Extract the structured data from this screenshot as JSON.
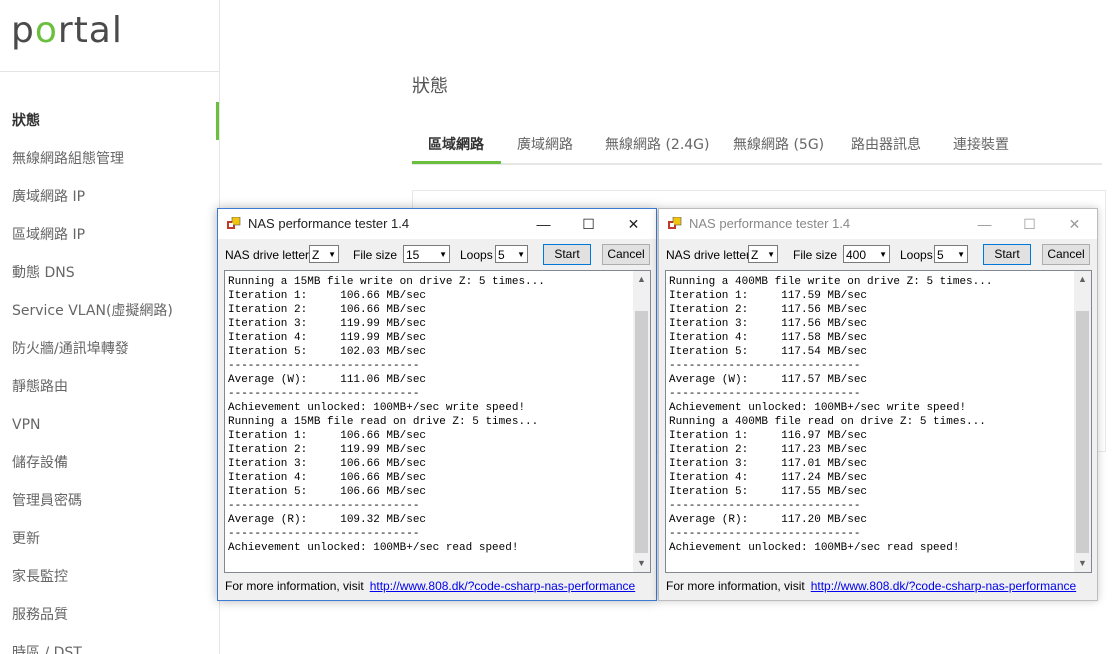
{
  "sidebar": {
    "logo": "portal",
    "items": [
      {
        "label": "狀態",
        "active": true
      },
      {
        "label": "無線網路組態管理"
      },
      {
        "label": "廣域網路 IP"
      },
      {
        "label": "區域網路 IP"
      },
      {
        "label": "動態 DNS"
      },
      {
        "label": "Service VLAN(虛擬網路)"
      },
      {
        "label": "防火牆/通訊埠轉發"
      },
      {
        "label": "靜態路由"
      },
      {
        "label": "VPN"
      },
      {
        "label": "儲存設備"
      },
      {
        "label": "管理員密碼"
      },
      {
        "label": "更新"
      },
      {
        "label": "家長監控"
      },
      {
        "label": "服務品質"
      },
      {
        "label": "時區 / DST"
      }
    ]
  },
  "main": {
    "title": "狀態",
    "tabs": [
      "區域網路",
      "廣域網路",
      "無線網路 (2.4G)",
      "無線網路 (5G)",
      "路由器訊息",
      "連接裝置"
    ]
  },
  "windows": [
    {
      "title": "NAS performance tester 1.4",
      "drive_label": "NAS drive letter",
      "drive_value": "Z",
      "filesize_label": "File size",
      "filesize_value": "15",
      "loops_label": "Loops",
      "loops_value": "5",
      "start_label": "Start",
      "cancel_label": "Cancel",
      "console": [
        "Running a 15MB file write on drive Z: 5 times...",
        "Iteration 1:     106.66 MB/sec",
        "Iteration 2:     106.66 MB/sec",
        "Iteration 3:     119.99 MB/sec",
        "Iteration 4:     119.99 MB/sec",
        "Iteration 5:     102.03 MB/sec",
        "-----------------------------",
        "Average (W):     111.06 MB/sec",
        "-----------------------------",
        "Achievement unlocked: 100MB+/sec write speed!",
        "Running a 15MB file read on drive Z: 5 times...",
        "Iteration 1:     106.66 MB/sec",
        "Iteration 2:     119.99 MB/sec",
        "Iteration 3:     106.66 MB/sec",
        "Iteration 4:     106.66 MB/sec",
        "Iteration 5:     106.66 MB/sec",
        "-----------------------------",
        "Average (R):     109.32 MB/sec",
        "-----------------------------",
        "Achievement unlocked: 100MB+/sec read speed!"
      ],
      "footer_text": "For more information, visit",
      "footer_link": "http://www.808.dk/?code-csharp-nas-performance"
    },
    {
      "title": "NAS performance tester 1.4",
      "drive_label": "NAS drive letter",
      "drive_value": "Z",
      "filesize_label": "File size",
      "filesize_value": "400",
      "loops_label": "Loops",
      "loops_value": "5",
      "start_label": "Start",
      "cancel_label": "Cancel",
      "console": [
        "Running a 400MB file write on drive Z: 5 times...",
        "Iteration 1:     117.59 MB/sec",
        "Iteration 2:     117.56 MB/sec",
        "Iteration 3:     117.56 MB/sec",
        "Iteration 4:     117.58 MB/sec",
        "Iteration 5:     117.54 MB/sec",
        "-----------------------------",
        "Average (W):     117.57 MB/sec",
        "-----------------------------",
        "Achievement unlocked: 100MB+/sec write speed!",
        "Running a 400MB file read on drive Z: 5 times...",
        "Iteration 1:     116.97 MB/sec",
        "Iteration 2:     117.23 MB/sec",
        "Iteration 3:     117.01 MB/sec",
        "Iteration 4:     117.24 MB/sec",
        "Iteration 5:     117.55 MB/sec",
        "-----------------------------",
        "Average (R):     117.20 MB/sec",
        "-----------------------------",
        "Achievement unlocked: 100MB+/sec read speed!"
      ],
      "footer_text": "For more information, visit",
      "footer_link": "http://www.808.dk/?code-csharp-nas-performance"
    }
  ],
  "icons": {
    "minimize": "minimize-icon",
    "maximize": "maximize-icon",
    "close": "close-icon",
    "app": "app-icon",
    "dropdown": "chevron-down-icon"
  },
  "colors": {
    "accent": "#6abf3e",
    "active_window_border": "#3a7bd5",
    "link": "#0000ee"
  }
}
